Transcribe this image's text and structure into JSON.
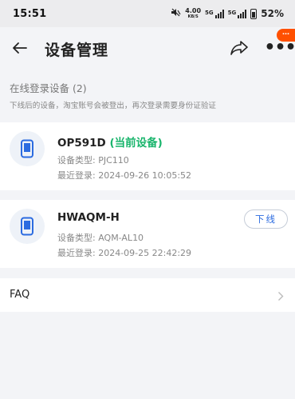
{
  "status_bar": {
    "time": "15:51",
    "net_speed_value": "4.00",
    "net_speed_unit": "KB/S",
    "sim1_label": "5G",
    "sim2_label": "5G",
    "battery": "52%"
  },
  "header": {
    "title": "设备管理",
    "more_badge": "…"
  },
  "section": {
    "title": "在线登录设备 (2)",
    "description": "下线后的设备，淘宝账号会被登出，再次登录需要身份证验证"
  },
  "devices": [
    {
      "name": "OP591D",
      "current_tag": "(当前设备)",
      "type": "设备类型: PJC110",
      "last_login": "最近登录: 2024-09-26 10:05:52"
    },
    {
      "name": "HWAQM-H",
      "type": "设备类型: AQM-AL10",
      "last_login": "最近登录: 2024-09-25 22:42:29",
      "logout_label": "下线"
    }
  ],
  "faq": {
    "label": "FAQ"
  },
  "colors": {
    "accent_blue": "#2b6be0",
    "current_green": "#18b46b",
    "badge_orange": "#ff5000"
  }
}
